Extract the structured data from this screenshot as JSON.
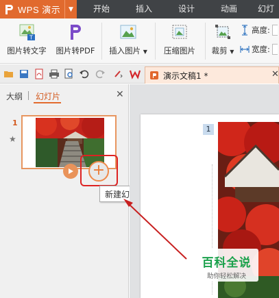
{
  "app": {
    "name": "WPS 演示"
  },
  "menu": {
    "tabs": [
      "开始",
      "插入",
      "设计",
      "动画",
      "幻灯片"
    ]
  },
  "ribbon": {
    "buttons": [
      "图片转文字",
      "图片转PDF",
      "插入图片",
      "压缩图片",
      "裁剪"
    ],
    "height_label": "高度:",
    "width_label": "宽度:"
  },
  "document": {
    "tab_title": "演示文稿1 *"
  },
  "left_panel": {
    "tab_outline": "大纲",
    "tab_slides": "幻灯片",
    "slide_number": "1",
    "tooltip": "新建幻灯片"
  },
  "canvas": {
    "slide_badge": "1"
  },
  "watermark": {
    "title": "百科全说",
    "subtitle": "助你轻松解决"
  },
  "colors": {
    "accent": "#e16a2e",
    "highlight": "#d22222",
    "watermark": "#1aa14b"
  },
  "icons": [
    "app-logo-icon",
    "picture-to-text-icon",
    "picture-to-pdf-icon",
    "insert-picture-icon",
    "compress-picture-icon",
    "crop-icon",
    "height-icon",
    "width-icon",
    "play-icon",
    "add-slide-icon",
    "star-icon",
    "close-icon"
  ]
}
